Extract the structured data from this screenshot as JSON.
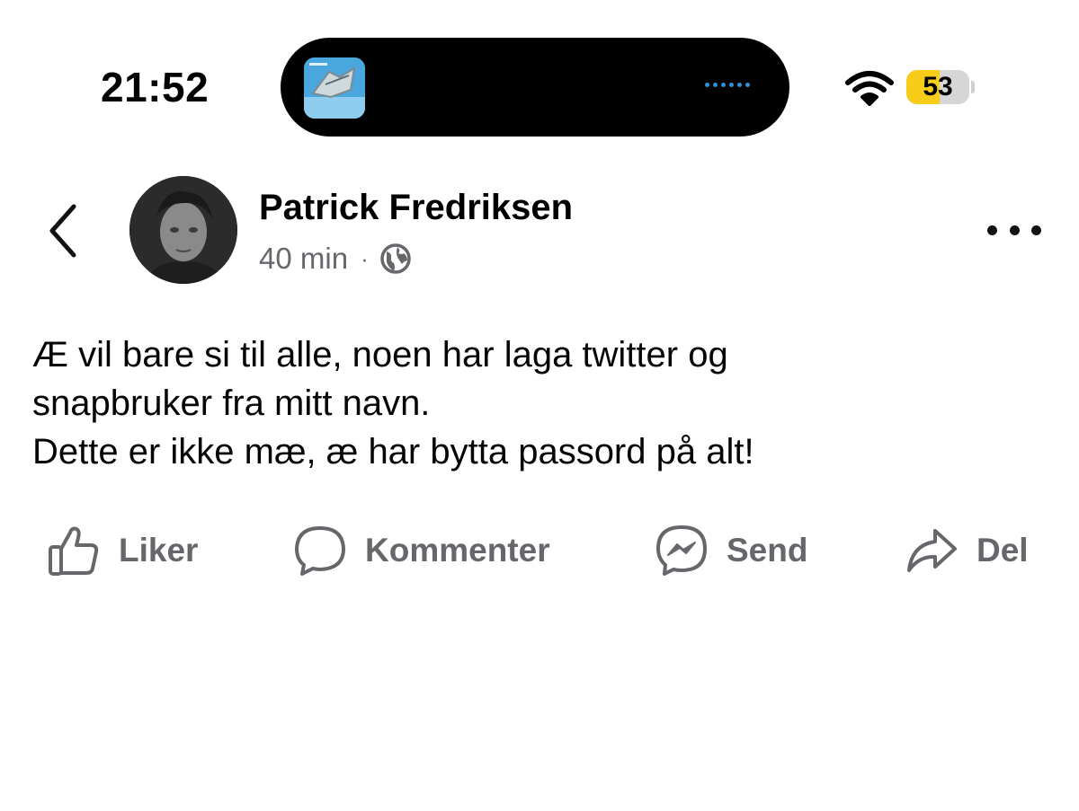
{
  "status_bar": {
    "time": "21:52",
    "battery_level": "53",
    "battery_fraction": 0.53,
    "wifi_icon": "wifi-icon",
    "now_playing_icon": "album-art-thumbnail"
  },
  "post": {
    "author_name": "Patrick Fredriksen",
    "timestamp": "40 min",
    "separator": "·",
    "audience_icon": "globe-icon",
    "body_lines": [
      "Æ vil bare si til alle, noen har laga twitter og",
      "snapbruker fra mitt navn.",
      "Dette er ikke mæ, æ har bytta passord på alt!"
    ]
  },
  "actions": {
    "like": {
      "label": "Liker",
      "icon": "thumbs-up-icon"
    },
    "comment": {
      "label": "Kommenter",
      "icon": "comment-bubble-icon"
    },
    "send": {
      "label": "Send",
      "icon": "messenger-icon"
    },
    "share": {
      "label": "Del",
      "icon": "share-arrow-icon"
    }
  },
  "colors": {
    "secondary_text": "#65676b",
    "battery_fill": "#f7cd1a",
    "island_dots": "#2f8fd8"
  }
}
